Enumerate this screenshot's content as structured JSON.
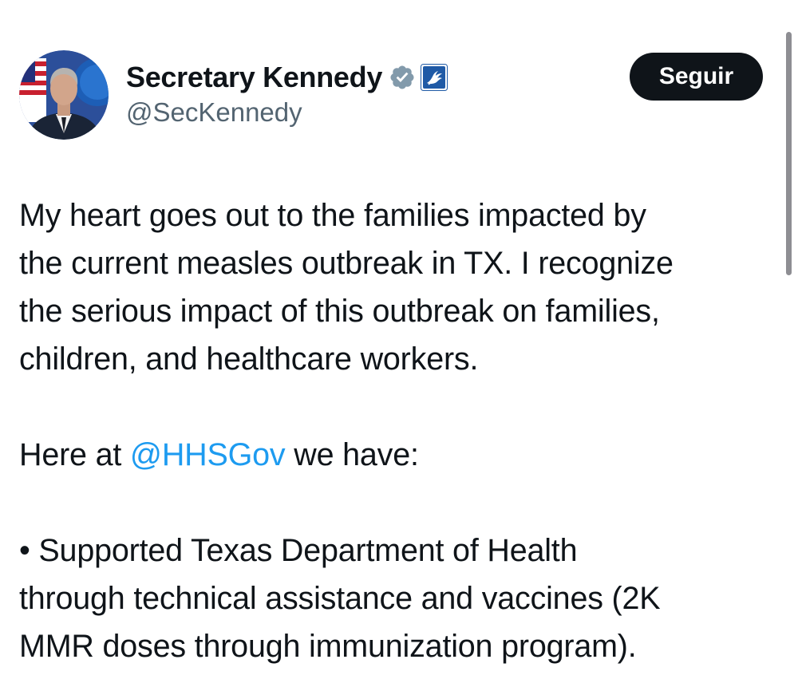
{
  "author": {
    "display_name": "Secretary Kennedy",
    "handle": "@SecKennedy",
    "verified_badge_icon": "gray-verified-badge-icon",
    "affiliate_icon": "hhs-eagle-logo-icon"
  },
  "follow_button": {
    "label": "Seguir"
  },
  "tweet": {
    "paragraph1": {
      "lines": [
        "My heart goes out to the families impacted by",
        "the current measles outbreak in TX. I recognize",
        "the serious impact of this outbreak on families,",
        "children, and healthcare workers."
      ]
    },
    "paragraph2": {
      "prefix": "Here at ",
      "mention": "@HHSGov",
      "suffix": " we have:"
    },
    "paragraph3": {
      "lines": [
        "• Supported Texas Department of Health",
        "through technical assistance and vaccines (2K",
        "MMR doses through immunization program)."
      ]
    }
  },
  "colors": {
    "text": "#0f1419",
    "secondary_text": "#536471",
    "mention": "#1d9bf0",
    "button_bg": "#0f1419",
    "button_text": "#ffffff",
    "badge_gray": "#829aab",
    "hhs_blue": "#1f5aa6"
  }
}
